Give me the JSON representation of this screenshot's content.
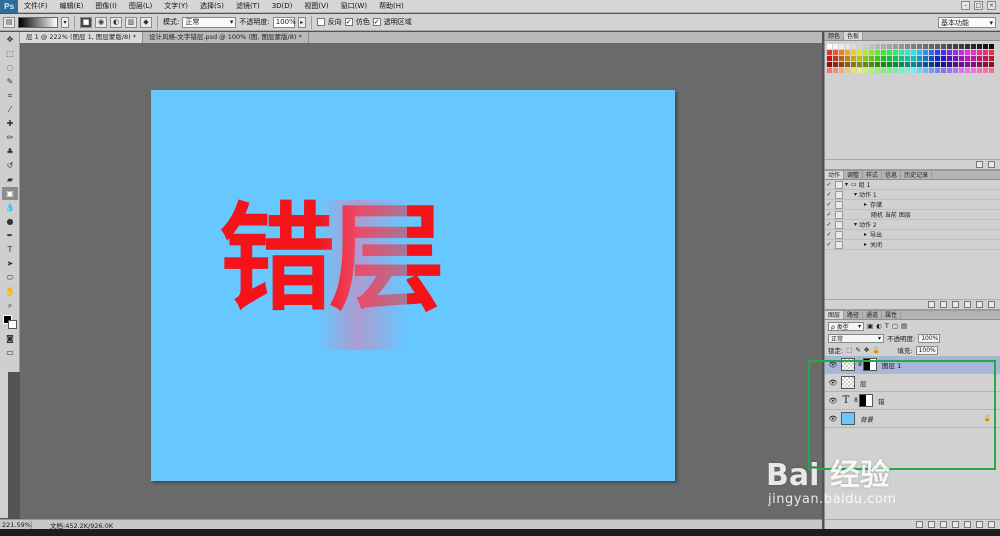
{
  "app": {
    "logo": "Ps"
  },
  "menu": [
    "文件(F)",
    "编辑(E)",
    "图像(I)",
    "图层(L)",
    "文字(Y)",
    "选择(S)",
    "滤镜(T)",
    "3D(D)",
    "视图(V)",
    "窗口(W)",
    "帮助(H)"
  ],
  "options": {
    "mode_label": "模式:",
    "mode_value": "正常",
    "opacity_label": "不透明度:",
    "opacity_value": "100%",
    "reverse_label": "反向",
    "dither_label": "仿色",
    "transparency_label": "透明区域",
    "workspace": "基本功能"
  },
  "doc_tabs": [
    {
      "label": "层 1 @ 222% (图层 1, 图层蒙版/8) *"
    },
    {
      "label": "设计风格-文字错层.psd @ 100% (图, 图层蒙版/8) *"
    }
  ],
  "canvas": {
    "text": "错层",
    "background": "#66c8ff",
    "text_color": "#f51218"
  },
  "status": {
    "zoom": "221.59%",
    "doc_size": "文档:452.2K/926.0K"
  },
  "swatches_panel": {
    "tabs": [
      "颜色",
      "色板"
    ]
  },
  "actions_panel": {
    "tabs": [
      "动作",
      "调整",
      "样式",
      "信息",
      "历史记录"
    ],
    "items": [
      {
        "label": "组 1"
      },
      {
        "label": "动作 1"
      },
      {
        "label": "存储"
      },
      {
        "label": "随机 当前 图层"
      },
      {
        "label": "动作 2"
      },
      {
        "label": "导出"
      },
      {
        "label": "关闭"
      }
    ]
  },
  "layers_panel": {
    "tabs": [
      "图层",
      "路径",
      "通道",
      "属性"
    ],
    "filter_label": "ρ 类型",
    "blend_mode": "正常",
    "opacity_label": "不透明度:",
    "opacity_value": "100%",
    "lock_label": "锁定:",
    "fill_label": "填充:",
    "fill_value": "100%",
    "layers": [
      {
        "name": "图层 1"
      },
      {
        "name": "层"
      },
      {
        "name": "错"
      },
      {
        "name": "背景"
      }
    ]
  },
  "watermark": {
    "main": "Bai 经验",
    "url": "jingyan.baidu.com"
  }
}
